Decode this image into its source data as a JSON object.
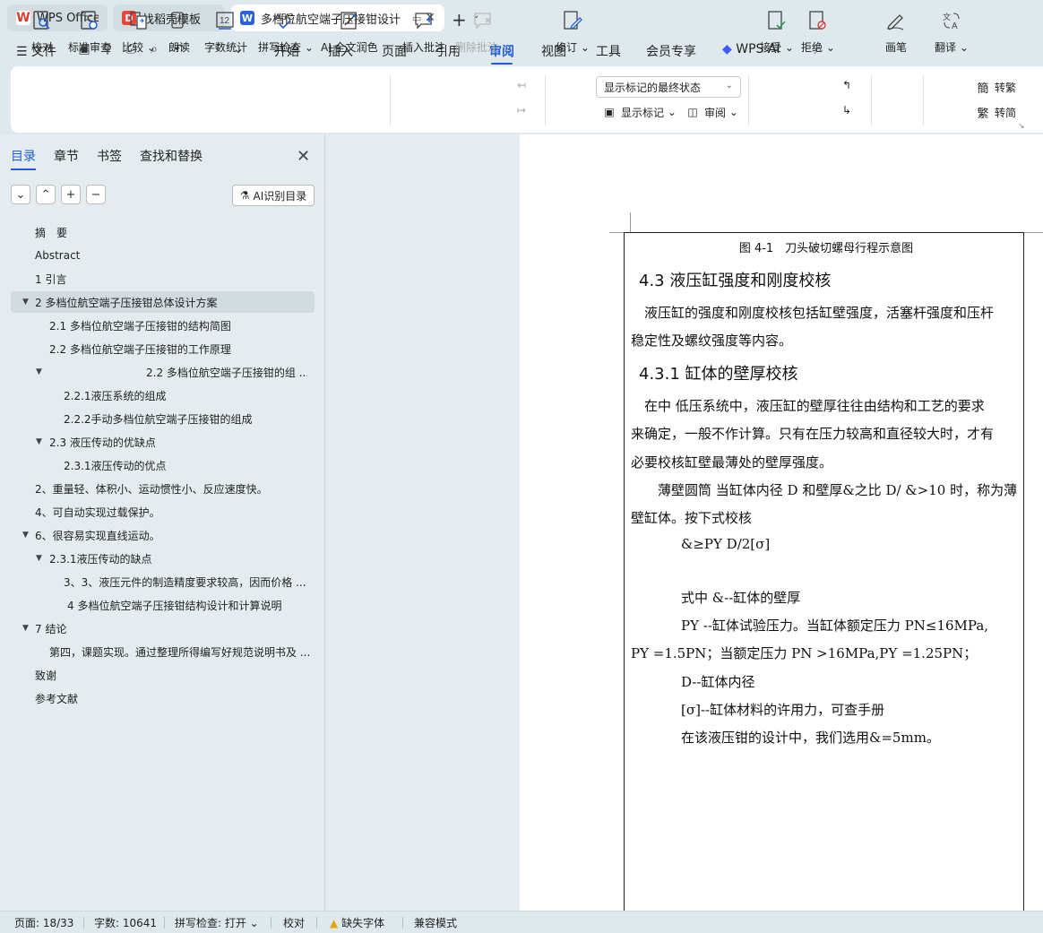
{
  "tabs": [
    {
      "label": "WPS Office",
      "icon": "wps-logo-icon"
    },
    {
      "label": "找稻壳模板",
      "icon": "docer-icon"
    },
    {
      "label": "多档位航空端子压接钳设计",
      "icon": "word-doc-icon"
    }
  ],
  "menu": {
    "file": "文件",
    "items": [
      "开始",
      "插入",
      "页面",
      "引用",
      "审阅",
      "视图",
      "工具",
      "会员专享"
    ],
    "active": "审阅",
    "wps_ai": "WPS AI"
  },
  "ribbon": {
    "proofread": "校对",
    "standard_review": "标准审查",
    "compare": "比较",
    "read_aloud": "朗读",
    "word_count": "字数统计",
    "spell_check": "拼写检查",
    "ai_polish": "AI 全文润色",
    "insert_comment": "插入批注",
    "delete_comment": "删除批注",
    "revise": "修订",
    "display_select": "显示标记的最终状态",
    "show_markup": "显示标记",
    "review_pane": "审阅",
    "accept": "接受",
    "reject": "拒绝",
    "pen": "画笔",
    "translate": "翻译",
    "to_traditional": "转繁",
    "to_simplified": "转简"
  },
  "nav": {
    "tabs": [
      "目录",
      "章节",
      "书签",
      "查找和替换"
    ],
    "ai_toc": "AI识别目录",
    "toc": [
      {
        "label": "摘　要"
      },
      {
        "label": "Abstract"
      },
      {
        "label": "1 引言"
      },
      {
        "label": "2 多档位航空端子压接钳总体设计方案"
      },
      {
        "label": "2.1 多档位航空端子压接钳的结构简图"
      },
      {
        "label": "2.2 多档位航空端子压接钳的工作原理"
      },
      {
        "label": "2.2 多档位航空端子压接钳的组 ..."
      },
      {
        "label": "2.2.1液压系统的组成"
      },
      {
        "label": "2.2.2手动多档位航空端子压接钳的组成"
      },
      {
        "label": "2.3 液压传动的优缺点"
      },
      {
        "label": "2.3.1液压传动的优点"
      },
      {
        "label": "2、重量轻、体积小、运动惯性小、反应速度快。"
      },
      {
        "label": "4、可自动实现过载保护。"
      },
      {
        "label": "6、很容易实现直线运动。"
      },
      {
        "label": "2.3.1液压传动的缺点"
      },
      {
        "label": "3、3、液压元件的制造精度要求较高，因而价格 ..."
      },
      {
        "label": "4 多档位航空端子压接钳结构设计和计算说明"
      },
      {
        "label": "7 结论"
      },
      {
        "label": "第四，课题实现。通过整理所得编写好规范说明书及 ..."
      },
      {
        "label": "致谢"
      },
      {
        "label": "参考文献"
      }
    ]
  },
  "document": {
    "caption": "图 4-1　刀头破切螺母行程示意图",
    "h_43": "4.3 液压缸强度和刚度校核",
    "p1a": "　液压缸的强度和刚度校核包括缸壁强度，活塞杆强度和压杆",
    "p1b": "稳定性及螺纹强度等内容。",
    "h_431": "4.3.1 缸体的壁厚校核",
    "p2a": "　在中  低压系统中，液压缸的壁厚往往由结构和工艺的要求",
    "p2b": "来确定，一般不作计算。只有在压力较高和直径较大时，才有",
    "p2c": "必要校核缸壁最薄处的壁厚强度。",
    "p3a": "　　薄壁圆筒  当缸体内径 D 和壁厚&之比 D/ &>10 时，称为薄",
    "p3b": "壁缸体。按下式校核",
    "formula": "&≥PY D/2[σ]",
    "where1": "式中 &--缸体的壁厚",
    "where2": "PY --缸体试验压力。当缸体额定压力 PN≤16MPa,",
    "where3": "PY =1.5PN；当额定压力 PN >16MPa,PY =1.25PN；",
    "where4": "D--缸体内径",
    "where5": "[σ]--缸体材料的许用力，可查手册",
    "p4": "在该液压钳的设计中，我们选用&=5mm。"
  },
  "status": {
    "page": "页面: 18/33",
    "words": "字数: 10641",
    "spell": "拼写检查: 打开",
    "proof": "校对",
    "missing_font": "缺失字体",
    "compat": "兼容模式"
  }
}
